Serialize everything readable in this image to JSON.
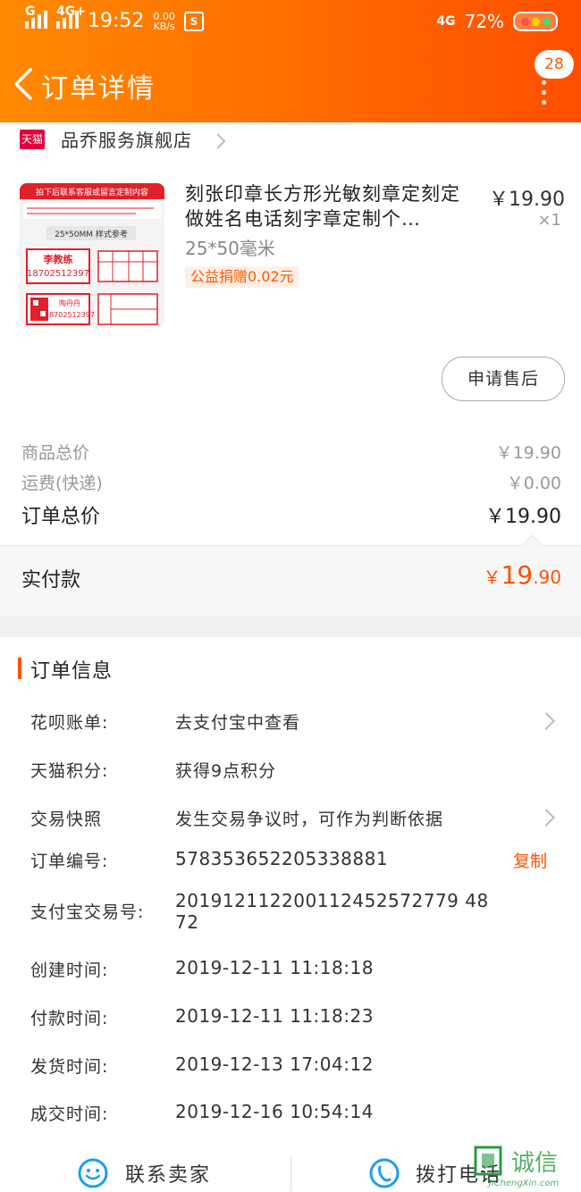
{
  "status_bar": {
    "network_left": "G",
    "network_4g": "4G+",
    "time": "19:52",
    "speed_value": "0.00",
    "speed_unit": "KB/s",
    "app_icon": "S",
    "network_right": "4G",
    "battery": "72%"
  },
  "nav": {
    "title": "订单详情",
    "badge": "28"
  },
  "shop": {
    "logo_text": "天猫",
    "name": "品乔服务旗舰店"
  },
  "product": {
    "title": "刻张印章长方形光敏刻章定刻定做姓名电话刻字章定制个…",
    "spec": "25*50毫米",
    "charity": "公益捐赠0.02元",
    "price": "￥19.90",
    "qty": "×1",
    "after_sale": "申请售后",
    "thumb": {
      "top_banner": "拍下后联系客服或留言定制内容",
      "size_label": "25*50MM 样式参考",
      "name1": "李教练",
      "phone1": "18702512397",
      "name2": "陶丹丹",
      "phone2": "18702512397"
    }
  },
  "summary": {
    "goods_label": "商品总价",
    "goods_value": "￥19.90",
    "shipping_label": "运费(快递)",
    "shipping_value": "￥0.00",
    "total_label": "订单总价",
    "total_value": "￥19.90",
    "paid_label": "实付款",
    "paid_currency": "￥",
    "paid_int": "19",
    "paid_dec": ".90"
  },
  "order_info": {
    "heading": "订单信息",
    "rows": [
      {
        "key": "花呗账单:",
        "value": "去支付宝中查看"
      },
      {
        "key": "天猫积分:",
        "value": "获得9点积分"
      },
      {
        "key": "交易快照",
        "value": "发生交易争议时，可作为判断依据"
      },
      {
        "key": "订单编号:",
        "value": "578353652205338881"
      },
      {
        "key": "支付宝交易号:",
        "value": "2019121122001124525727794872"
      },
      {
        "key": "创建时间:",
        "value": "2019-12-11 11:18:18"
      },
      {
        "key": "付款时间:",
        "value": "2019-12-11 11:18:23"
      },
      {
        "key": "发货时间:",
        "value": "2019-12-13 17:04:12"
      },
      {
        "key": "成交时间:",
        "value": "2019-12-16 10:54:14"
      }
    ],
    "alipay_line1": "201912112200112452572779 48",
    "alipay_line2": "72",
    "copy_label": "复制"
  },
  "bottom_bar": {
    "contact_seller": "联系卖家",
    "call": "拨打电话"
  },
  "watermark": {
    "cn": "诚信",
    "en": "JiChengXin.com"
  },
  "colors": {
    "accent": "#ff5000",
    "header_start": "#ff8a00",
    "header_end": "#ff4e00",
    "tmall_red": "#e4003a",
    "icon_blue": "#1aa0f0"
  }
}
